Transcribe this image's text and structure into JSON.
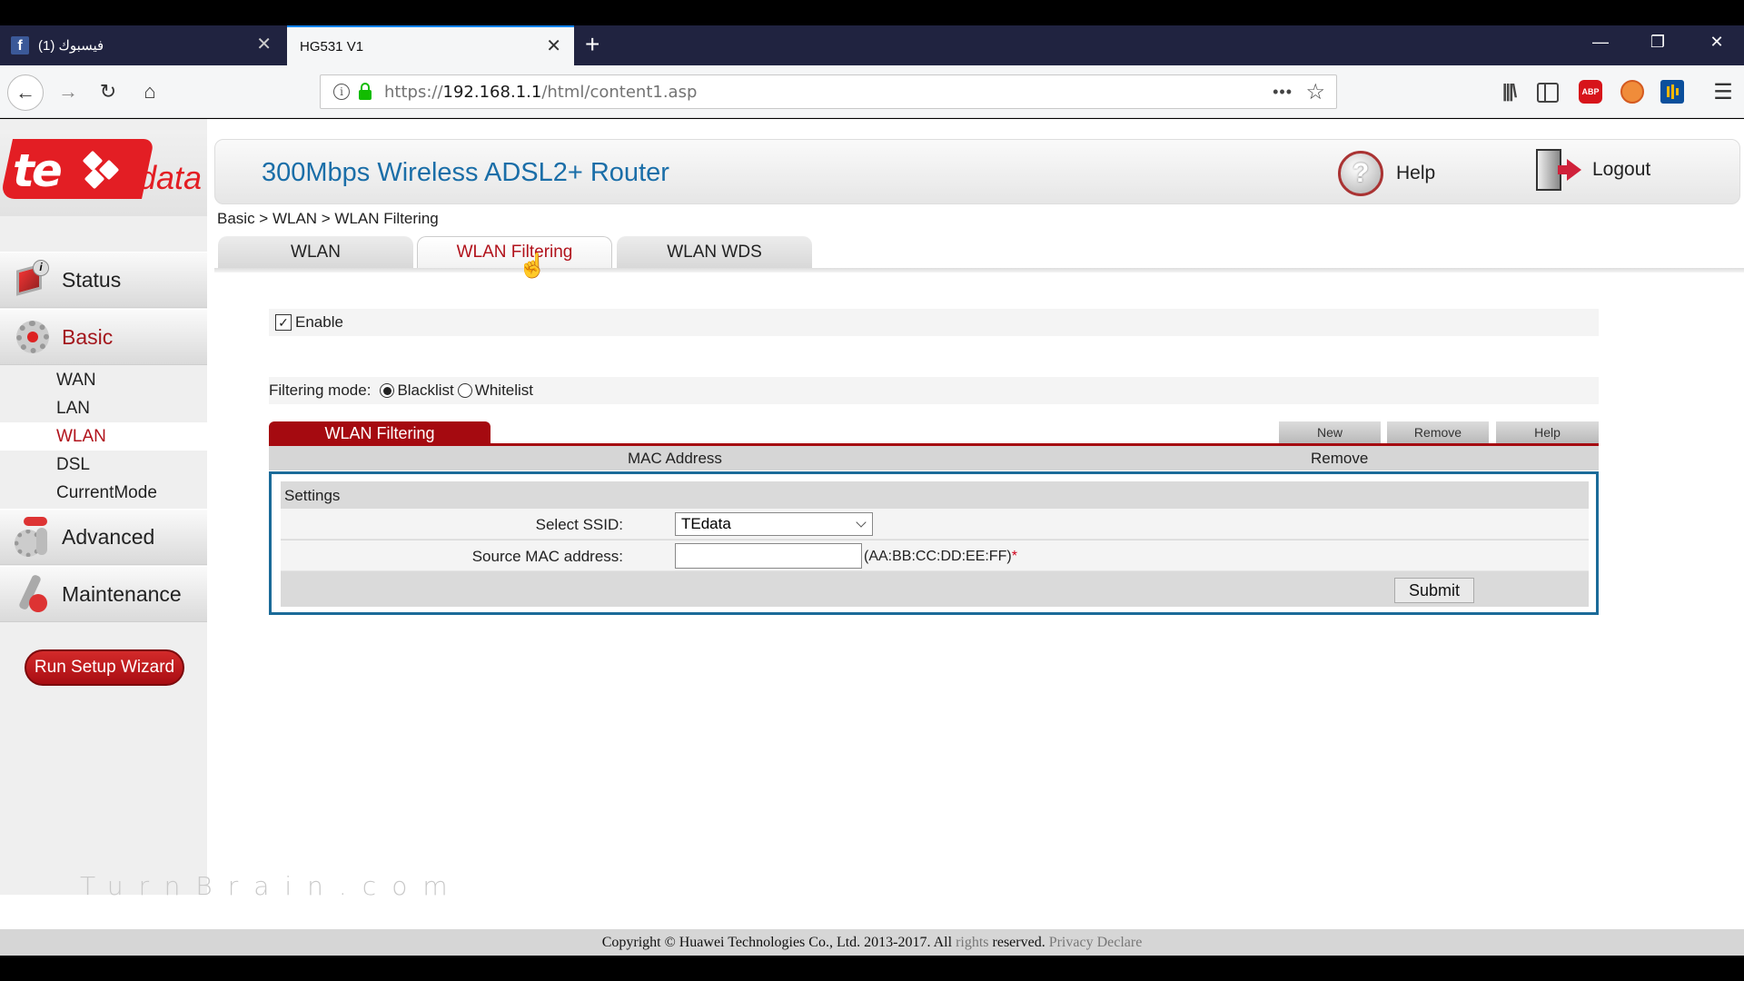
{
  "browser": {
    "tabs": [
      {
        "title": "(1) فيسبوك",
        "icon": "facebook-icon",
        "active": false
      },
      {
        "title": "HG531 V1",
        "active": true
      }
    ],
    "url": {
      "scheme": "https://",
      "host": "192.168.1.1",
      "path": "/html/content1.asp"
    },
    "window_controls": [
      "minimize",
      "restore",
      "close"
    ],
    "toolbar_icons": [
      "library-icon",
      "sidebar-icon",
      "adblock-plus-icon",
      "extension-icon",
      "stats-extension-icon",
      "menu-icon"
    ],
    "abp_label": "ABP"
  },
  "brand": {
    "logo_main": "te",
    "logo_suffix": "data",
    "accent": "#e31e24"
  },
  "header": {
    "title": "300Mbps Wireless ADSL2+ Router",
    "help_label": "Help",
    "logout_label": "Logout",
    "title_color": "#1a6ea8"
  },
  "breadcrumb": "Basic > WLAN > WLAN Filtering",
  "page_tabs": [
    {
      "label": "WLAN",
      "active": false
    },
    {
      "label": "WLAN Filtering",
      "active": true
    },
    {
      "label": "WLAN WDS",
      "active": false
    }
  ],
  "sidebar": {
    "main": [
      {
        "label": "Status",
        "icon": "status-monitor-icon",
        "active": false
      },
      {
        "label": "Basic",
        "icon": "gear-icon",
        "active": true
      },
      {
        "label": "Advanced",
        "icon": "advanced-gear-icon",
        "active": false
      },
      {
        "label": "Maintenance",
        "icon": "wrench-icon",
        "active": false
      }
    ],
    "basic_sub": [
      {
        "label": "WAN",
        "active": false
      },
      {
        "label": "LAN",
        "active": false
      },
      {
        "label": "WLAN",
        "active": true
      },
      {
        "label": "DSL",
        "active": false
      },
      {
        "label": "CurrentMode",
        "active": false
      }
    ],
    "wizard_label": "Run Setup Wizard"
  },
  "filter": {
    "enable_label": "Enable",
    "enabled": true,
    "mode_label": "Filtering mode:",
    "modes": [
      {
        "label": "Blacklist",
        "selected": true
      },
      {
        "label": "Whitelist",
        "selected": false
      }
    ]
  },
  "table": {
    "title": "WLAN Filtering",
    "buttons": {
      "new": "New",
      "remove": "Remove",
      "help": "Help"
    },
    "columns": [
      "MAC Address",
      "Remove"
    ],
    "rows": []
  },
  "settings": {
    "heading": "Settings",
    "ssid_label": "Select SSID:",
    "ssid_value": "TEdata",
    "mac_label": "Source MAC address:",
    "mac_value": "",
    "mac_hint": "(AA:BB:CC:DD:EE:FF)",
    "required_mark": "*",
    "submit_label": "Submit"
  },
  "watermark": "TurnBrain.com",
  "footer": {
    "part1": "Copyright © Huawei Technologies Co., Ltd. 2013-2017. All ",
    "part2": "rights",
    "part3": " reserved. ",
    "privacy": "Privacy Declare"
  }
}
